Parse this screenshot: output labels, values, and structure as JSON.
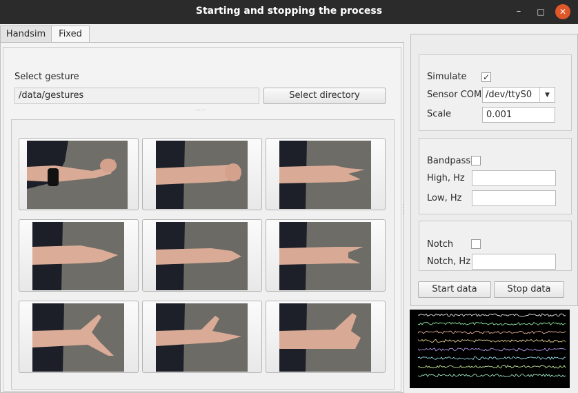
{
  "window": {
    "title": "Starting and stopping the process",
    "minimize_glyph": "–",
    "maximize_glyph": "□",
    "close_glyph": "✕"
  },
  "tabs": [
    {
      "label": "Handsim",
      "active": false
    },
    {
      "label": "Fixed",
      "active": true
    }
  ],
  "gesture_panel": {
    "select_label": "Select gesture",
    "directory_value": "/data/gestures",
    "select_directory_button": "Select directory",
    "splitter_glyph": "......",
    "gestures": [
      {
        "icon": "hand-fist-gesture-icon"
      },
      {
        "icon": "hand-fist-flat-gesture-icon"
      },
      {
        "icon": "hand-two-fingers-gesture-icon"
      },
      {
        "icon": "hand-open-flat-gesture-icon"
      },
      {
        "icon": "hand-flat-side-gesture-icon"
      },
      {
        "icon": "hand-index-pinky-gesture-icon"
      },
      {
        "icon": "hand-thumb-pinky-gesture-icon"
      },
      {
        "icon": "hand-thumb-index-gesture-icon"
      },
      {
        "icon": "hand-thumb-up-gesture-icon"
      }
    ]
  },
  "settings": {
    "simulate_label": "Simulate",
    "simulate_checked": true,
    "check_glyph": "✓",
    "sensor_com_label": "Sensor COM",
    "sensor_com_value": "/dev/ttyS0",
    "combo_arrow_glyph": "▼",
    "scale_label": "Scale",
    "scale_value": "0.001",
    "bandpass_label": "Bandpass",
    "bandpass_checked": false,
    "high_label": "High, Hz",
    "high_value": "",
    "low_label": "Low, Hz",
    "low_value": "",
    "notch_label": "Notch",
    "notch_checked": false,
    "notch_hz_label": "Notch, Hz",
    "notch_hz_value": "",
    "start_button": "Start data",
    "stop_button": "Stop data"
  },
  "signal_plot": {
    "channel_colors": [
      "#ffffff",
      "#9cffb0",
      "#ffc2a6",
      "#ffe9a6",
      "#c7a6ff",
      "#a6f0ff",
      "#d9ffa6",
      "#b0ffd6"
    ],
    "background": "#000000"
  }
}
